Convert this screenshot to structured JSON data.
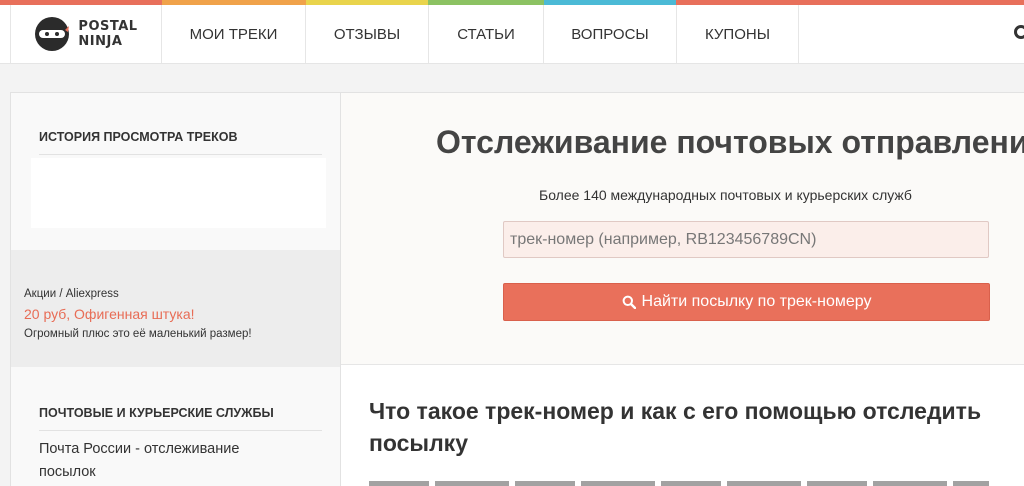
{
  "color_strip": [
    "#e8705b",
    "#f0a24a",
    "#e9d44c",
    "#8cc263",
    "#4bbad6",
    "#e8705b"
  ],
  "logo": {
    "line1": "POSTAL",
    "line2": "NINJA"
  },
  "nav": {
    "items": [
      {
        "label": "МОИ ТРЕКИ"
      },
      {
        "label": "ОТЗЫВЫ"
      },
      {
        "label": "СТАТЬИ"
      },
      {
        "label": "ВОПРОСЫ"
      },
      {
        "label": "КУПОНЫ"
      }
    ]
  },
  "sidebar": {
    "history_title": "ИСТОРИЯ ПРОСМОТРА ТРЕКОВ",
    "promo": {
      "category": "Акции / Aliexpress",
      "deal": "20 руб, Офигенная штука!",
      "description": "Огромный плюс это её маленький размер!"
    },
    "services_title": "ПОЧТОВЫЕ И КУРЬЕРСКИЕ СЛУЖБЫ",
    "services_link": "Почта России - отслеживание посылок"
  },
  "main": {
    "title": "Отслеживание почтовых отправлений",
    "subtitle": "Более 140 международных почтовых и курьерских служб",
    "input_placeholder": "трек-номер (например, RB123456789CN)",
    "search_button": "Найти посылку по трек-номеру",
    "article_title": "Что такое трек-номер и как с его помощью отследить посылку"
  },
  "icons": {
    "logo": "ninja-icon",
    "search_button": "search-icon",
    "header_right": "search-icon"
  },
  "colors": {
    "accent": "#e9705b",
    "promo_text": "#e86c55"
  }
}
